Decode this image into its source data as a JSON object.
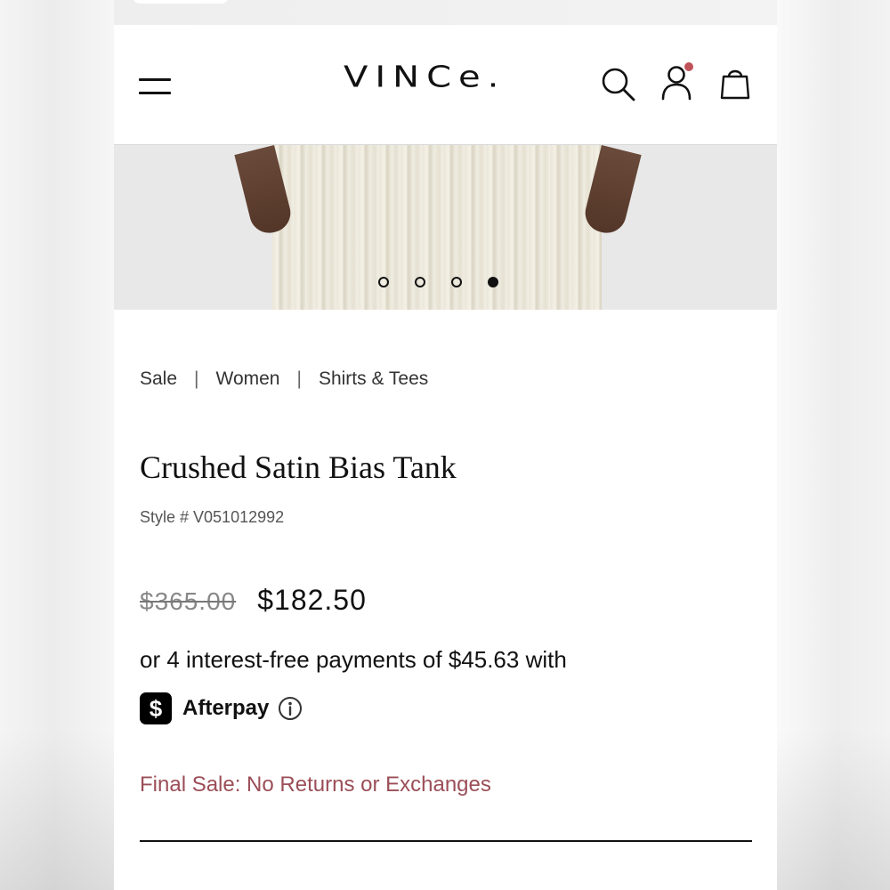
{
  "header": {
    "logo": "VINCe.",
    "menu_icon": "hamburger-menu-icon",
    "search_icon": "search-icon",
    "account_icon": "user-account-icon",
    "bag_icon": "shopping-bag-icon",
    "notification_color": "#c0525a"
  },
  "gallery": {
    "slide_count": 4,
    "active_slide": 4
  },
  "breadcrumb": [
    "Sale",
    "Women",
    "Shirts & Tees"
  ],
  "product": {
    "title": "Crushed Satin Bias Tank",
    "style": "Style # V051012992",
    "original_price": "$365.00",
    "sale_price": "$182.50",
    "installments": "or 4 interest-free payments of $45.63 with",
    "afterpay_badge": "$",
    "afterpay_label": "Afterpay",
    "final_sale": "Final Sale: No Returns or Exchanges",
    "final_sale_color": "#9b4e57"
  }
}
